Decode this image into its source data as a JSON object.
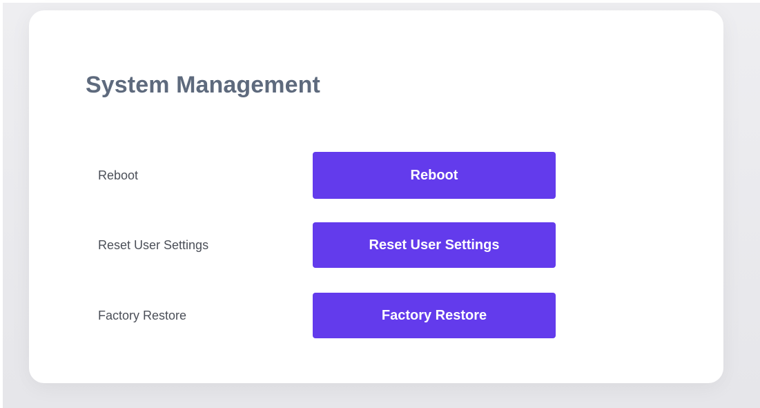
{
  "page": {
    "title": "System Management"
  },
  "colors": {
    "accent": "#633bec",
    "title_text": "#5e6a7d",
    "label_text": "#4b4f58",
    "backdrop": "#e9e9ed",
    "card": "#ffffff"
  },
  "rows": [
    {
      "label": "Reboot",
      "button_label": "Reboot"
    },
    {
      "label": "Reset User Settings",
      "button_label": "Reset User Settings"
    },
    {
      "label": "Factory Restore",
      "button_label": "Factory Restore"
    }
  ]
}
